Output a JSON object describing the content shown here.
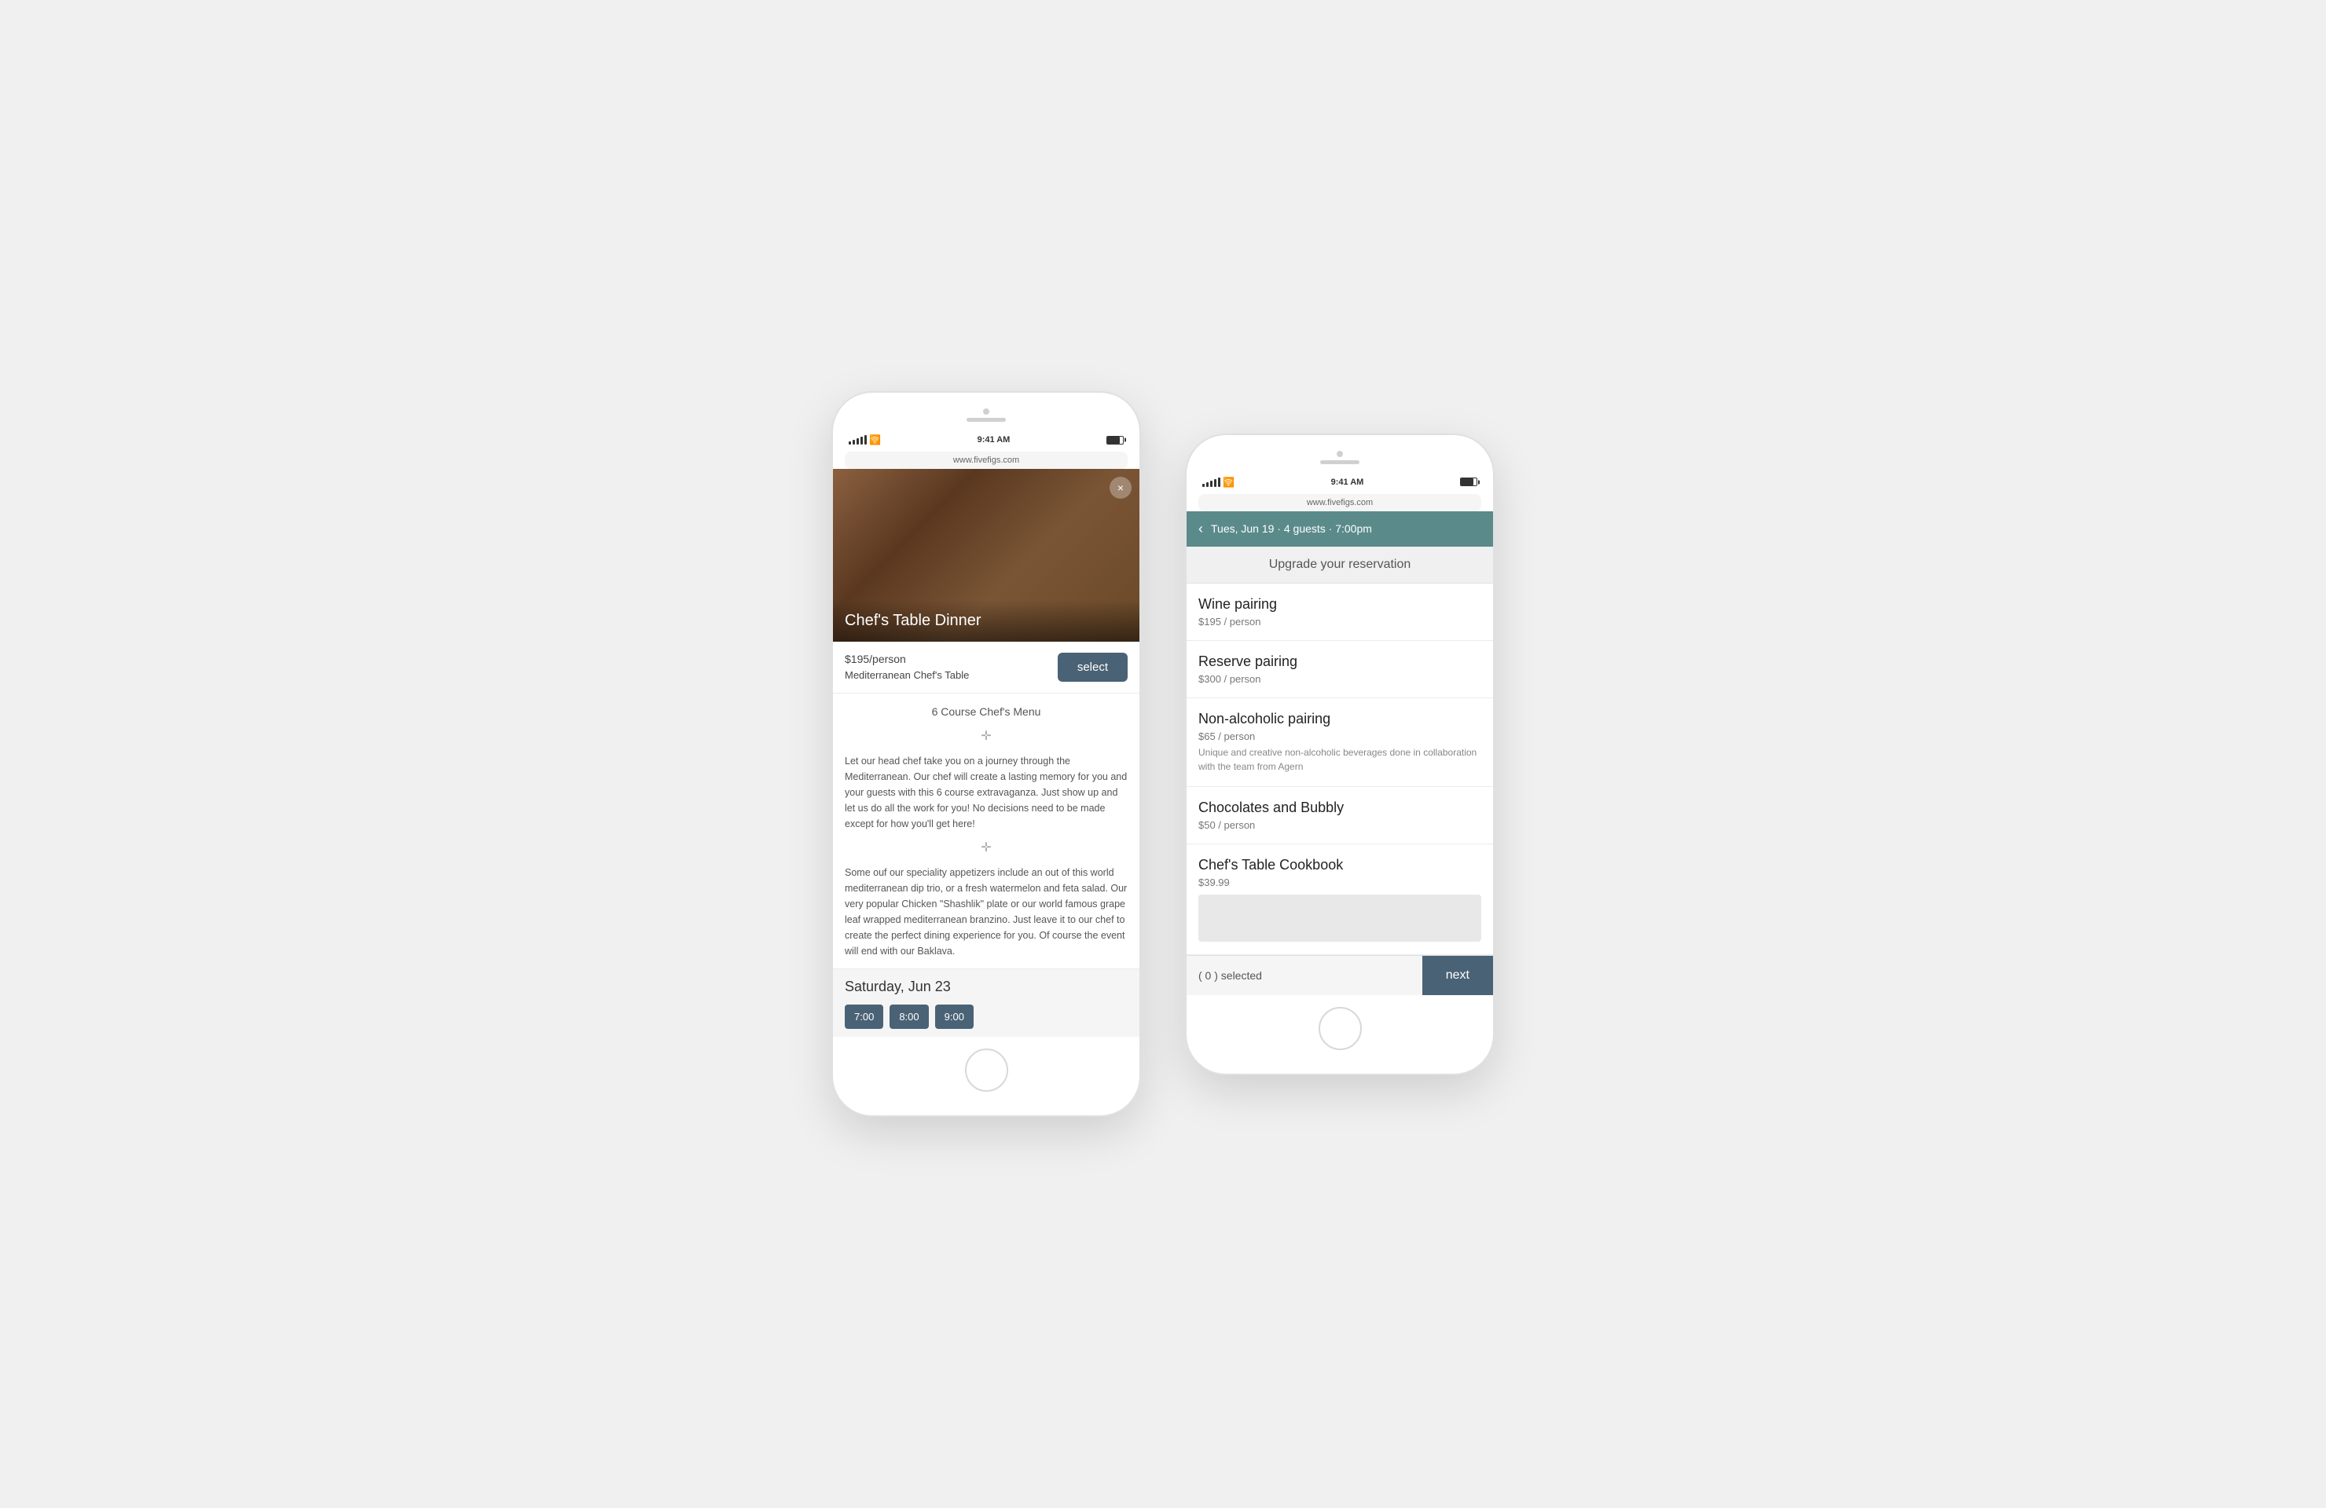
{
  "phone1": {
    "status": {
      "time": "9:41 AM",
      "url": "www.fivefigs.com"
    },
    "food_image": {
      "title": "Chef's Table Dinner",
      "close_label": "×"
    },
    "select_section": {
      "price": "$195/person",
      "name": "Mediterranean Chef's Table",
      "select_label": "select"
    },
    "menu": {
      "course_title": "6 Course Chef's Menu",
      "para1": "Let our head chef take you on a journey through the Mediterranean. Our chef will create a lasting memory for you and your guests with this 6 course extravaganza. Just show up and let us do all the work for you! No decisions need to be made except for how you'll get here!",
      "para2": "Some ouf our speciality appetizers include an out of this world mediterranean dip trio, or a fresh watermelon and feta salad. Our very popular Chicken \"Shashlik\" plate or our world famous grape leaf wrapped mediterranean branzino. Just leave it to our chef to create the perfect dining experience for you. Of course the event will end with our Baklava."
    },
    "date_bar": {
      "label": "Saturday, Jun 23"
    },
    "time_slots": [
      "7:00",
      "8:00",
      "9:00"
    ]
  },
  "phone2": {
    "status": {
      "time": "9:41 AM",
      "url": "www.fivefigs.com"
    },
    "reservation_header": {
      "date": "Tues, Jun 19 · 4 guests · 7:00pm",
      "back_label": "‹"
    },
    "upgrade_title": "Upgrade your reservation",
    "upgrades": [
      {
        "name": "Wine pairing",
        "price": "$195 / person",
        "desc": ""
      },
      {
        "name": "Reserve pairing",
        "price": "$300 / person",
        "desc": ""
      },
      {
        "name": "Non-alcoholic pairing",
        "price": "$65 / person",
        "desc": "Unique and creative non-alcoholic beverages done in collaboration with the team from Agern"
      },
      {
        "name": "Chocolates and Bubbly",
        "price": "$50 / person",
        "desc": ""
      },
      {
        "name": "Chef's Table Cookbook",
        "price": "$39.99",
        "desc": "",
        "has_preview": true
      }
    ],
    "bottom_bar": {
      "selected_label": "( 0 ) selected",
      "next_label": "next"
    }
  }
}
